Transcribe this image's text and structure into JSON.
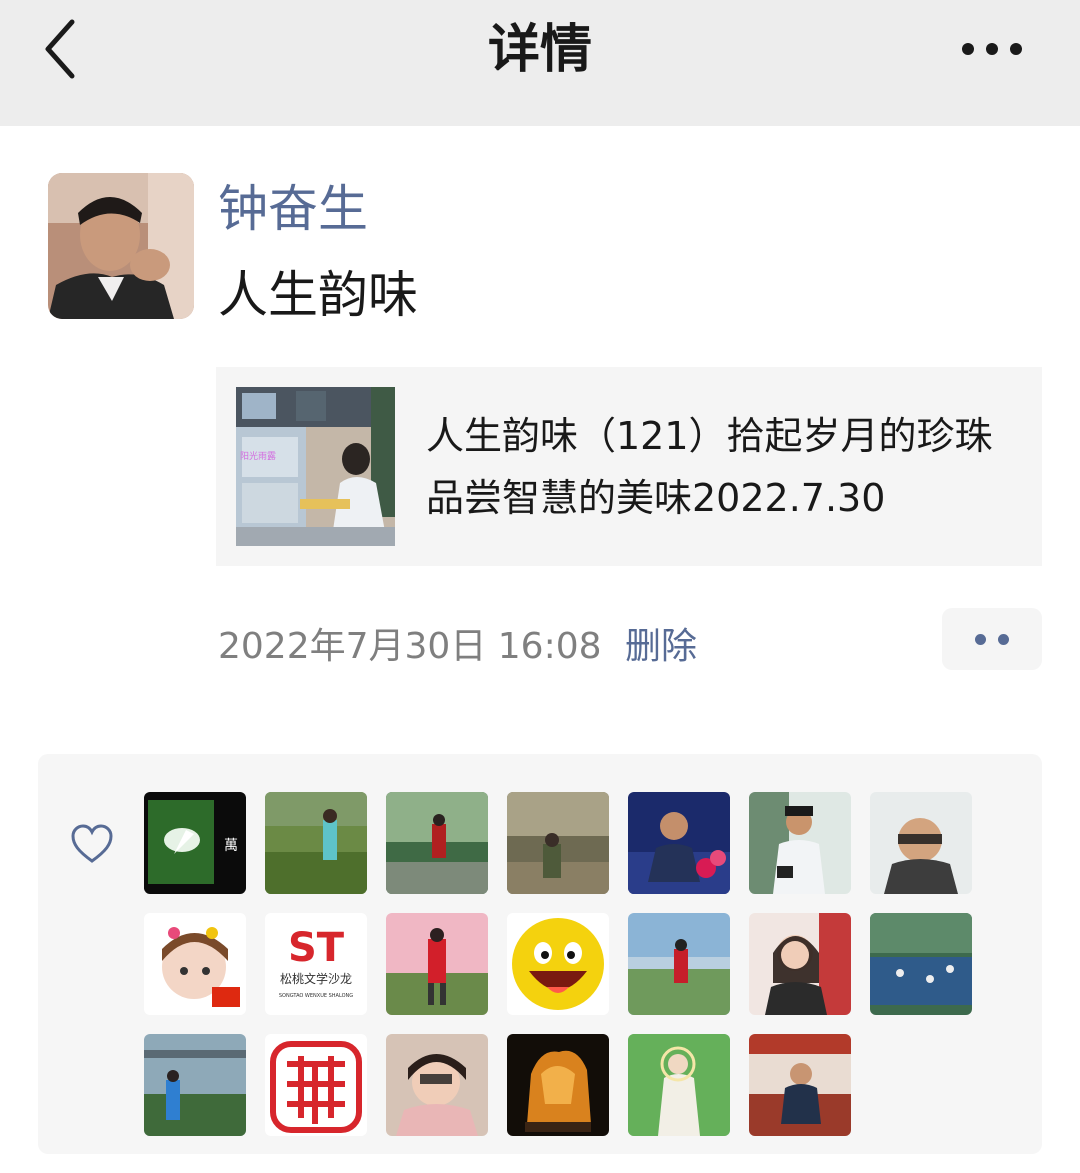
{
  "nav": {
    "title": "详情"
  },
  "post": {
    "author": "钟奋生",
    "text": "人生韵味",
    "link_title": "人生韵味（121）拾起岁月的珍珠 品尝智慧的美味2022.7.30",
    "thumb_overlay_text": "阳光雨露",
    "timestamp": "2022年7月30日 16:08",
    "delete_label": "删除"
  },
  "likes": {
    "avatars": [
      {
        "name": "like-avatar-1",
        "text": "萬"
      },
      {
        "name": "like-avatar-2"
      },
      {
        "name": "like-avatar-3"
      },
      {
        "name": "like-avatar-4"
      },
      {
        "name": "like-avatar-5"
      },
      {
        "name": "like-avatar-6"
      },
      {
        "name": "like-avatar-7"
      },
      {
        "name": "like-avatar-8"
      },
      {
        "name": "like-avatar-9",
        "text": "ST",
        "subtext": "松桃文学沙龙",
        "subtext2": "SONGTAO WENXUE SHALONG"
      },
      {
        "name": "like-avatar-10"
      },
      {
        "name": "like-avatar-11"
      },
      {
        "name": "like-avatar-12"
      },
      {
        "name": "like-avatar-13"
      },
      {
        "name": "like-avatar-14"
      },
      {
        "name": "like-avatar-15"
      },
      {
        "name": "like-avatar-16"
      },
      {
        "name": "like-avatar-17"
      },
      {
        "name": "like-avatar-18"
      },
      {
        "name": "like-avatar-19"
      },
      {
        "name": "like-avatar-20"
      }
    ]
  },
  "colors": {
    "link_blue": "#576b95",
    "nav_bg": "#ededed",
    "card_bg": "#f5f5f5",
    "st_red": "#d7262c"
  }
}
